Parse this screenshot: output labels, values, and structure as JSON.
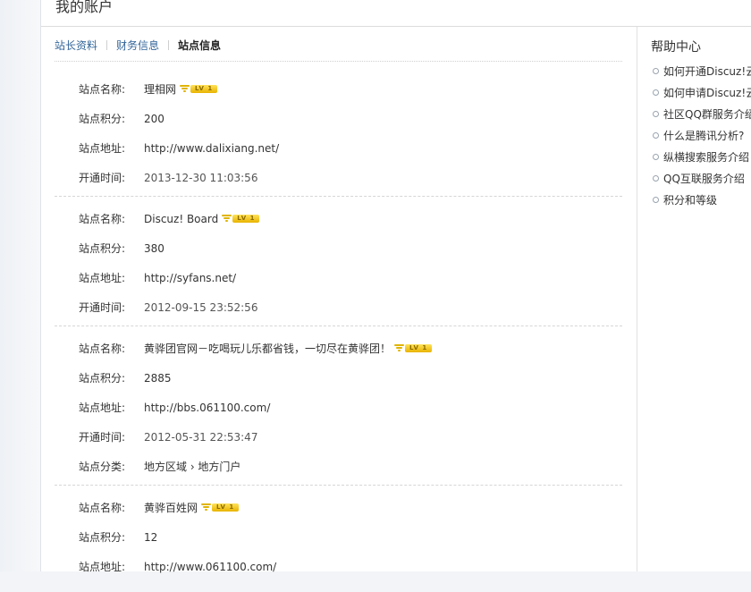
{
  "page": {
    "title": "我的账户"
  },
  "tabs": [
    {
      "label": "站长资料"
    },
    {
      "label": "财务信息"
    },
    {
      "label": "站点信息"
    }
  ],
  "badge_text": "LV 1",
  "field_labels": {
    "name": "站点名称:",
    "points": "站点积分:",
    "url": "站点地址:",
    "opened": "开通时间:",
    "category": "站点分类:"
  },
  "sites": [
    {
      "name": "理相网",
      "points": "200",
      "url": "http://www.dalixiang.net/",
      "opened": "2013-12-30 11:03:56"
    },
    {
      "name": "Discuz! Board",
      "points": "380",
      "url": "http://syfans.net/",
      "opened": "2012-09-15 23:52:56"
    },
    {
      "name": "黄骅团官网－吃喝玩儿乐都省钱，一切尽在黄骅团！",
      "points": "2885",
      "url": "http://bbs.061100.com/",
      "opened": "2012-05-31 22:53:47",
      "category": "地方区域 › 地方门户"
    },
    {
      "name": "黄骅百姓网",
      "points": "12",
      "url": "http://www.061100.com/"
    }
  ],
  "help": {
    "title": "帮助中心",
    "items": [
      "如何开通Discuz!云",
      "如何申请Discuz!云",
      "社区QQ群服务介绍",
      "什么是腾讯分析?",
      "纵横搜索服务介绍",
      "QQ互联服务介绍",
      "积分和等级"
    ]
  }
}
